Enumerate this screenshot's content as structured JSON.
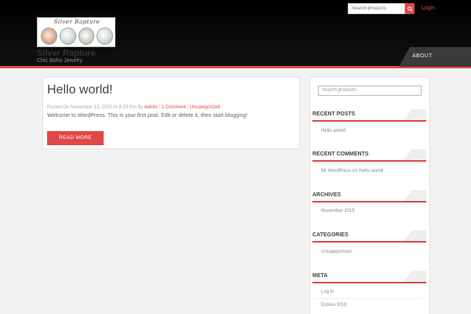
{
  "header": {
    "logo_text": "Silver Rapture",
    "site_title": "Silver Rapture",
    "tagline": "Chic Boho Jewelry",
    "search_placeholder": "Search products",
    "login_label": "Login",
    "nav": [
      {
        "label": "ABOUT"
      }
    ]
  },
  "post": {
    "title": "Hello world!",
    "meta_prefix": "Posted On November 13, 2015 At 8:29 Pm By",
    "meta_author": "Admin",
    "meta_sep1": " / ",
    "meta_comments": "1 Comment",
    "meta_sep2": " / ",
    "meta_category": "Uncategorized",
    "excerpt": "Welcome to WordPress. This is your first post. Edit or delete it, then start blogging!",
    "read_more": "READ MORE"
  },
  "sidebar": {
    "search_placeholder": "Search products",
    "recent_posts": {
      "title": "RECENT POSTS",
      "items": [
        "Hello world!"
      ]
    },
    "recent_comments": {
      "title": "RECENT COMMENTS",
      "commenter": "Mr WordPress",
      "on": " on ",
      "post": "Hello world!"
    },
    "archives": {
      "title": "ARCHIVES",
      "items": [
        "November 2015"
      ]
    },
    "categories": {
      "title": "CATEGORIES",
      "items": [
        "Uncategorized"
      ]
    },
    "meta": {
      "title": "META",
      "items": [
        "Log in",
        "Entries RSS"
      ]
    }
  },
  "colors": {
    "accent": "#e04848",
    "header_bg": "#000000",
    "page_bg": "#f2f2f2"
  }
}
